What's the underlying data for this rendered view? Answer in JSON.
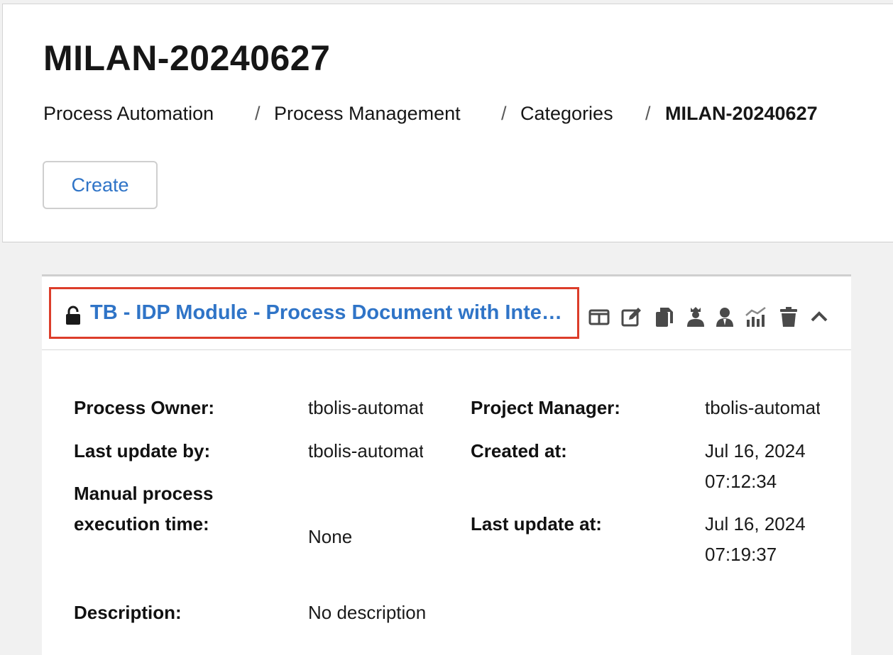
{
  "header": {
    "title": "MILAN-20240627",
    "breadcrumb": [
      {
        "label": "Process Automation"
      },
      {
        "label": "Process Management"
      },
      {
        "label": "Categories"
      },
      {
        "label": "MILAN-20240627"
      }
    ],
    "separator": "/",
    "create_label": "Create"
  },
  "card": {
    "title": "TB - IDP Module - Process Document with Integration Service",
    "locked_state": "unlocked",
    "tools": [
      "columns-icon",
      "edit-icon",
      "copy-icon",
      "owner-icon",
      "user-icon",
      "analytics-icon",
      "trash-icon",
      "chevron-up-icon"
    ],
    "fields": {
      "process_owner_label": "Process Owner:",
      "process_owner": "tbolis-automation",
      "project_manager_label": "Project Manager:",
      "project_manager": "tbolis-automation",
      "last_update_by_label": "Last update by:",
      "last_update_by": "tbolis-automation",
      "created_at_label": "Created at:",
      "created_at": "Jul 16, 2024\n07:12:34",
      "manual_time_label": "Manual process\nexecution time:",
      "manual_time": "None",
      "last_update_at_label": "Last update at:",
      "last_update_at": "Jul 16, 2024\n07:19:37",
      "description_label": "Description:",
      "description": "No description"
    }
  },
  "colors": {
    "accent": "#2f74c7",
    "highlight": "#dc3d2a",
    "icon": "#4a4a4a"
  }
}
